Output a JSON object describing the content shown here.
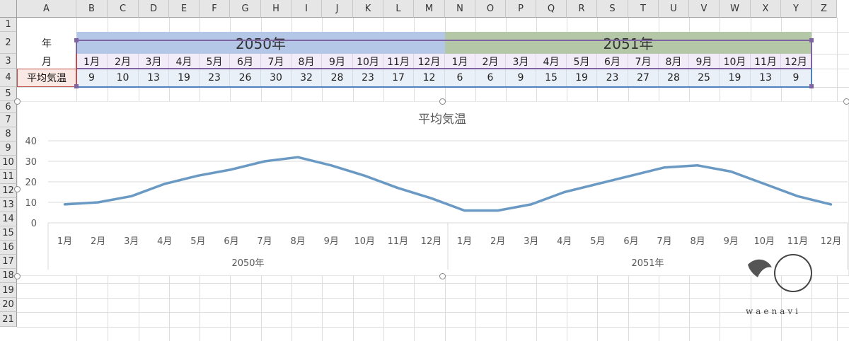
{
  "columns": [
    "A",
    "B",
    "C",
    "D",
    "E",
    "F",
    "G",
    "H",
    "I",
    "J",
    "K",
    "L",
    "M",
    "N",
    "O",
    "P",
    "Q",
    "R",
    "S",
    "T",
    "U",
    "V",
    "W",
    "X",
    "Y",
    "Z"
  ],
  "rows": [
    "1",
    "2",
    "3",
    "4",
    "5",
    "6",
    "7",
    "8",
    "9",
    "10",
    "11",
    "12",
    "13",
    "14",
    "15",
    "16",
    "17",
    "18",
    "19",
    "20",
    "21"
  ],
  "table": {
    "row2_label": "年",
    "row3_label": "月",
    "row4_label": "平均気温",
    "year1": "2050年",
    "year2": "2051年",
    "months": [
      "1月",
      "2月",
      "3月",
      "4月",
      "5月",
      "6月",
      "7月",
      "8月",
      "9月",
      "10月",
      "11月",
      "12月",
      "1月",
      "2月",
      "3月",
      "4月",
      "5月",
      "6月",
      "7月",
      "8月",
      "9月",
      "10月",
      "11月",
      "12月"
    ],
    "temps": [
      "9",
      "10",
      "13",
      "19",
      "23",
      "26",
      "30",
      "32",
      "28",
      "23",
      "17",
      "12",
      "6",
      "6",
      "9",
      "15",
      "19",
      "23",
      "27",
      "28",
      "25",
      "19",
      "13",
      "9"
    ]
  },
  "colors": {
    "year1_fill": "#b4c7e7",
    "year2_fill": "#b4c8a8",
    "line": "#6a9ac4"
  },
  "chart_data": {
    "type": "line",
    "title": "平均気温",
    "categories": [
      "1月",
      "2月",
      "3月",
      "4月",
      "5月",
      "6月",
      "7月",
      "8月",
      "9月",
      "10月",
      "11月",
      "12月",
      "1月",
      "2月",
      "3月",
      "4月",
      "5月",
      "6月",
      "7月",
      "8月",
      "9月",
      "10月",
      "11月",
      "12月"
    ],
    "category_groups": [
      {
        "label": "2050年",
        "count": 12
      },
      {
        "label": "2051年",
        "count": 12
      }
    ],
    "series": [
      {
        "values": [
          9,
          10,
          13,
          19,
          23,
          26,
          30,
          32,
          28,
          23,
          17,
          12,
          6,
          6,
          9,
          15,
          19,
          23,
          27,
          28,
          25,
          19,
          13,
          9
        ]
      }
    ],
    "yticks": [
      "0",
      "10",
      "20",
      "30",
      "40"
    ],
    "ylim": [
      0,
      40
    ],
    "grid": true,
    "legend": "none"
  },
  "watermark_text": "waenavi"
}
